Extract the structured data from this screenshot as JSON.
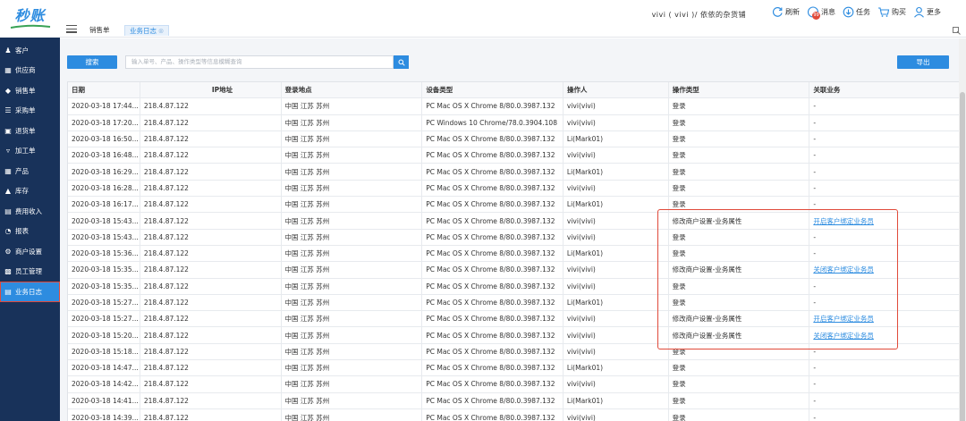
{
  "logo": "秒账",
  "sidebar": {
    "items": [
      {
        "label": "客户",
        "icon": "users-icon"
      },
      {
        "label": "供应商",
        "icon": "supplier-icon"
      },
      {
        "label": "销售单",
        "icon": "tag-icon"
      },
      {
        "label": "采购单",
        "icon": "cart-icon"
      },
      {
        "label": "退货单",
        "icon": "return-icon"
      },
      {
        "label": "加工单",
        "icon": "process-icon"
      },
      {
        "label": "产品",
        "icon": "box-icon"
      },
      {
        "label": "库存",
        "icon": "warehouse-icon"
      },
      {
        "label": "费用收入",
        "icon": "finance-icon"
      },
      {
        "label": "报表",
        "icon": "pie-chart-icon"
      },
      {
        "label": "商户设置",
        "icon": "gear-icon"
      },
      {
        "label": "员工管理",
        "icon": "staff-icon"
      },
      {
        "label": "业务日志",
        "icon": "log-icon",
        "active": true
      }
    ]
  },
  "topbar": {
    "tabs": [
      {
        "label": "销售单"
      },
      {
        "label": "业务日志",
        "active": true
      }
    ],
    "shop": "vivi ( vivi )/ 依依的杂货铺",
    "actions": [
      {
        "label": "刷新",
        "icon": "refresh-icon"
      },
      {
        "label": "消息",
        "icon": "message-icon",
        "badge": "99"
      },
      {
        "label": "任务",
        "icon": "task-icon"
      },
      {
        "label": "购买",
        "icon": "cart-icon"
      },
      {
        "label": "更多",
        "icon": "user-icon"
      }
    ]
  },
  "toolbar": {
    "search_label": "搜索",
    "search_placeholder": "输入单号、产品、操作类型等信息模糊查询",
    "export_label": "导出"
  },
  "table": {
    "columns": [
      "日期",
      "IP地址",
      "登录地点",
      "设备类型",
      "操作人",
      "操作类型",
      "关联业务"
    ],
    "rows": [
      [
        "2020-03-18 17:44...",
        "218.4.87.122",
        "中国  江苏  苏州",
        "PC Mac OS X Chrome 8/80.0.3987.132",
        "vivi(vivi)",
        "登录",
        "-"
      ],
      [
        "2020-03-18 17:20...",
        "218.4.87.122",
        "中国  江苏  苏州",
        "PC Windows 10 Chrome/78.0.3904.108",
        "vivi(vivi)",
        "登录",
        "-"
      ],
      [
        "2020-03-18 16:50...",
        "218.4.87.122",
        "中国  江苏  苏州",
        "PC Mac OS X Chrome 8/80.0.3987.132",
        "Li(Mark01)",
        "登录",
        "-"
      ],
      [
        "2020-03-18 16:48...",
        "218.4.87.122",
        "中国  江苏  苏州",
        "PC Mac OS X Chrome 8/80.0.3987.132",
        "vivi(vivi)",
        "登录",
        "-"
      ],
      [
        "2020-03-18 16:29...",
        "218.4.87.122",
        "中国  江苏  苏州",
        "PC Mac OS X Chrome 8/80.0.3987.132",
        "Li(Mark01)",
        "登录",
        "-"
      ],
      [
        "2020-03-18 16:28...",
        "218.4.87.122",
        "中国  江苏  苏州",
        "PC Mac OS X Chrome 8/80.0.3987.132",
        "vivi(vivi)",
        "登录",
        "-"
      ],
      [
        "2020-03-18 16:17...",
        "218.4.87.122",
        "中国  江苏  苏州",
        "PC Mac OS X Chrome 8/80.0.3987.132",
        "Li(Mark01)",
        "登录",
        "-"
      ],
      [
        "2020-03-18 15:43...",
        "218.4.87.122",
        "中国  江苏  苏州",
        "PC Mac OS X Chrome 8/80.0.3987.132",
        "vivi(vivi)",
        "修改商户设置-业务属性",
        "开启客户绑定业务员"
      ],
      [
        "2020-03-18 15:43...",
        "218.4.87.122",
        "中国  江苏  苏州",
        "PC Mac OS X Chrome 8/80.0.3987.132",
        "vivi(vivi)",
        "登录",
        "-"
      ],
      [
        "2020-03-18 15:36...",
        "218.4.87.122",
        "中国  江苏  苏州",
        "PC Mac OS X Chrome 8/80.0.3987.132",
        "Li(Mark01)",
        "登录",
        "-"
      ],
      [
        "2020-03-18 15:35...",
        "218.4.87.122",
        "中国  江苏  苏州",
        "PC Mac OS X Chrome 8/80.0.3987.132",
        "vivi(vivi)",
        "修改商户设置-业务属性",
        "关闭客户绑定业务员"
      ],
      [
        "2020-03-18 15:35...",
        "218.4.87.122",
        "中国  江苏  苏州",
        "PC Mac OS X Chrome 8/80.0.3987.132",
        "vivi(vivi)",
        "登录",
        "-"
      ],
      [
        "2020-03-18 15:27...",
        "218.4.87.122",
        "中国  江苏  苏州",
        "PC Mac OS X Chrome 8/80.0.3987.132",
        "Li(Mark01)",
        "登录",
        "-"
      ],
      [
        "2020-03-18 15:27...",
        "218.4.87.122",
        "中国  江苏  苏州",
        "PC Mac OS X Chrome 8/80.0.3987.132",
        "vivi(vivi)",
        "修改商户设置-业务属性",
        "开启客户绑定业务员"
      ],
      [
        "2020-03-18 15:20...",
        "218.4.87.122",
        "中国  江苏  苏州",
        "PC Mac OS X Chrome 8/80.0.3987.132",
        "vivi(vivi)",
        "修改商户设置-业务属性",
        "关闭客户绑定业务员"
      ],
      [
        "2020-03-18 15:18...",
        "218.4.87.122",
        "中国  江苏  苏州",
        "PC Mac OS X Chrome 8/80.0.3987.132",
        "vivi(vivi)",
        "登录",
        "-"
      ],
      [
        "2020-03-18 14:47...",
        "218.4.87.122",
        "中国  江苏  苏州",
        "PC Mac OS X Chrome 8/80.0.3987.132",
        "Li(Mark01)",
        "登录",
        "-"
      ],
      [
        "2020-03-18 14:42...",
        "218.4.87.122",
        "中国  江苏  苏州",
        "PC Mac OS X Chrome 8/80.0.3987.132",
        "vivi(vivi)",
        "登录",
        "-"
      ],
      [
        "2020-03-18 14:41...",
        "218.4.87.122",
        "中国  江苏  苏州",
        "PC Mac OS X Chrome 8/80.0.3987.132",
        "Li(Mark01)",
        "登录",
        "-"
      ],
      [
        "2020-03-18 14:39...",
        "218.4.87.122",
        "中国  江苏  苏州",
        "PC Mac OS X Chrome 8/80.0.3987.132",
        "vivi(vivi)",
        "登录",
        "-"
      ]
    ]
  },
  "colors": {
    "sidebar_bg": "#18325a",
    "accent": "#2d8ce0",
    "highlight": "#e04a3a"
  }
}
